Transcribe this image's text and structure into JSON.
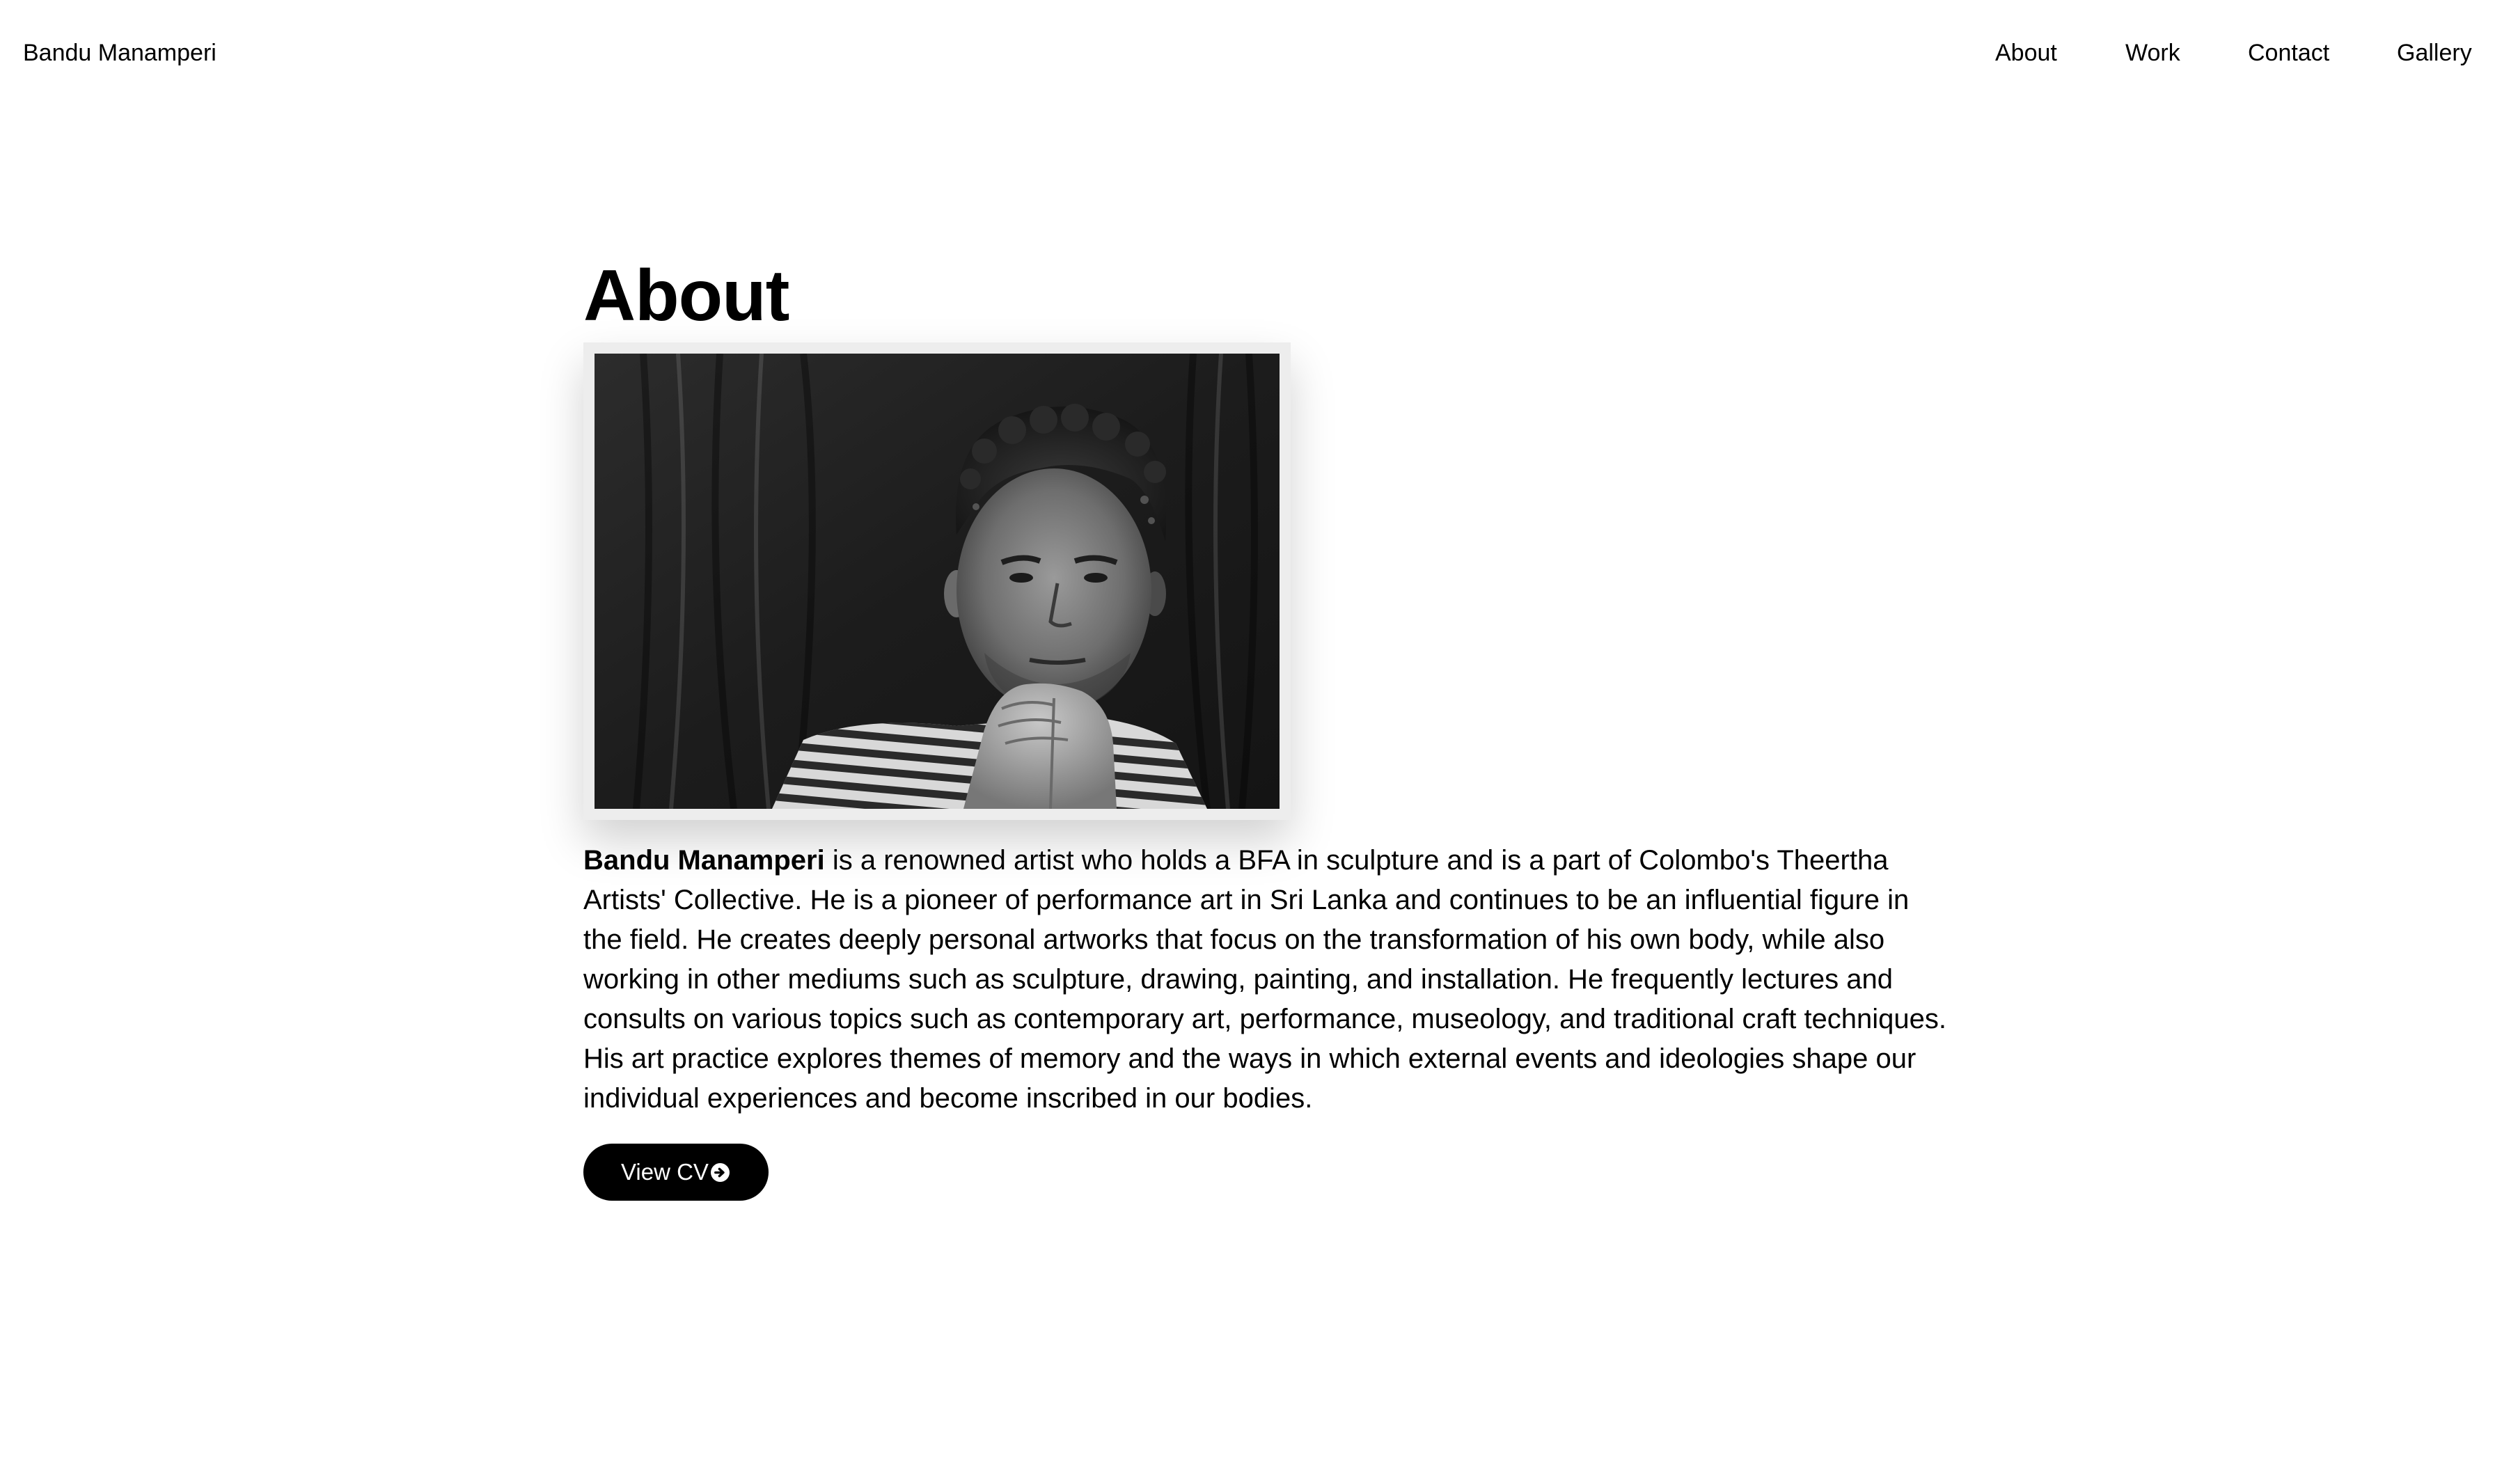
{
  "header": {
    "brand": "Bandu Manamperi",
    "nav": [
      {
        "label": "About"
      },
      {
        "label": "Work"
      },
      {
        "label": "Contact"
      },
      {
        "label": "Gallery"
      }
    ]
  },
  "main": {
    "title": "About",
    "bio": {
      "name": "Bandu Manamperi",
      "text": " is a renowned artist who holds a BFA in sculpture and is a part of Colombo's Theertha Artists' Collective. He is a pioneer of performance art in Sri Lanka and continues to be an influential figure in the field. He creates deeply personal artworks that focus on the transformation of his own body, while also working in other mediums such as sculpture, drawing, painting, and installation. He frequently lectures and consults on various topics such as contemporary art, performance, museology, and traditional craft techniques. His art practice explores themes of memory and the ways in which external events and ideologies shape our individual experiences and become inscribed in our bodies."
    },
    "cv_button": {
      "label": "View CV",
      "icon": "arrow-circle-right-icon"
    }
  },
  "colors": {
    "background": "#ffffff",
    "text": "#000000",
    "button_bg": "#000000",
    "button_text": "#ffffff",
    "photo_frame": "#ededed"
  }
}
